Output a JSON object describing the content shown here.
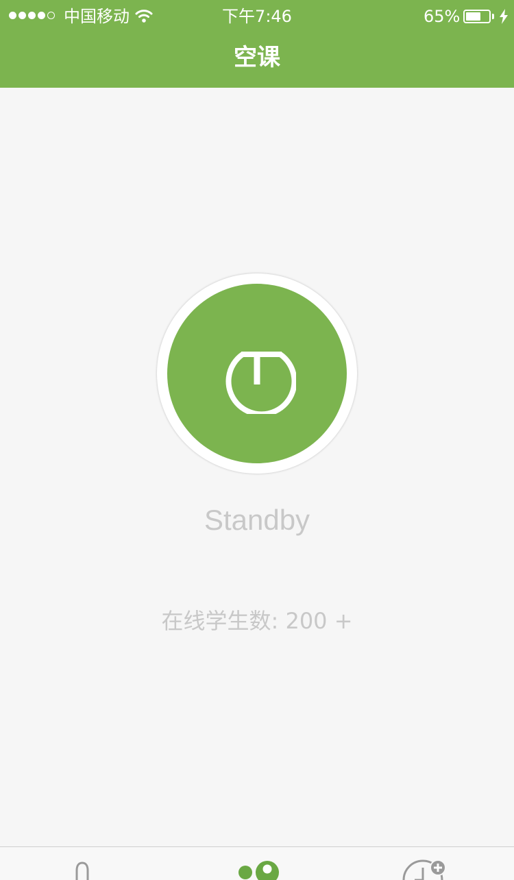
{
  "status_bar": {
    "carrier": "中国移动",
    "time": "下午7:46",
    "battery_percent": "65%",
    "battery_level": 0.65,
    "signal_bars_filled": 4,
    "signal_bars_total": 5,
    "icons": [
      "wifi-icon",
      "battery-icon",
      "charging-icon"
    ]
  },
  "nav": {
    "title": "空课"
  },
  "main": {
    "state_label": "Standby",
    "online_label": "在线学生数:",
    "online_count": "200 +",
    "button_icon": "standby-power-icon"
  },
  "tabbar": {
    "icons": [
      "microphone-icon",
      "classroom-icon",
      "add-schedule-icon"
    ]
  },
  "colors": {
    "accent": "#7cb44f",
    "background": "#f6f6f6",
    "muted_text": "#c8c8c8",
    "tab_active": "#6aa844",
    "tab_inactive": "#9a9a9a"
  }
}
